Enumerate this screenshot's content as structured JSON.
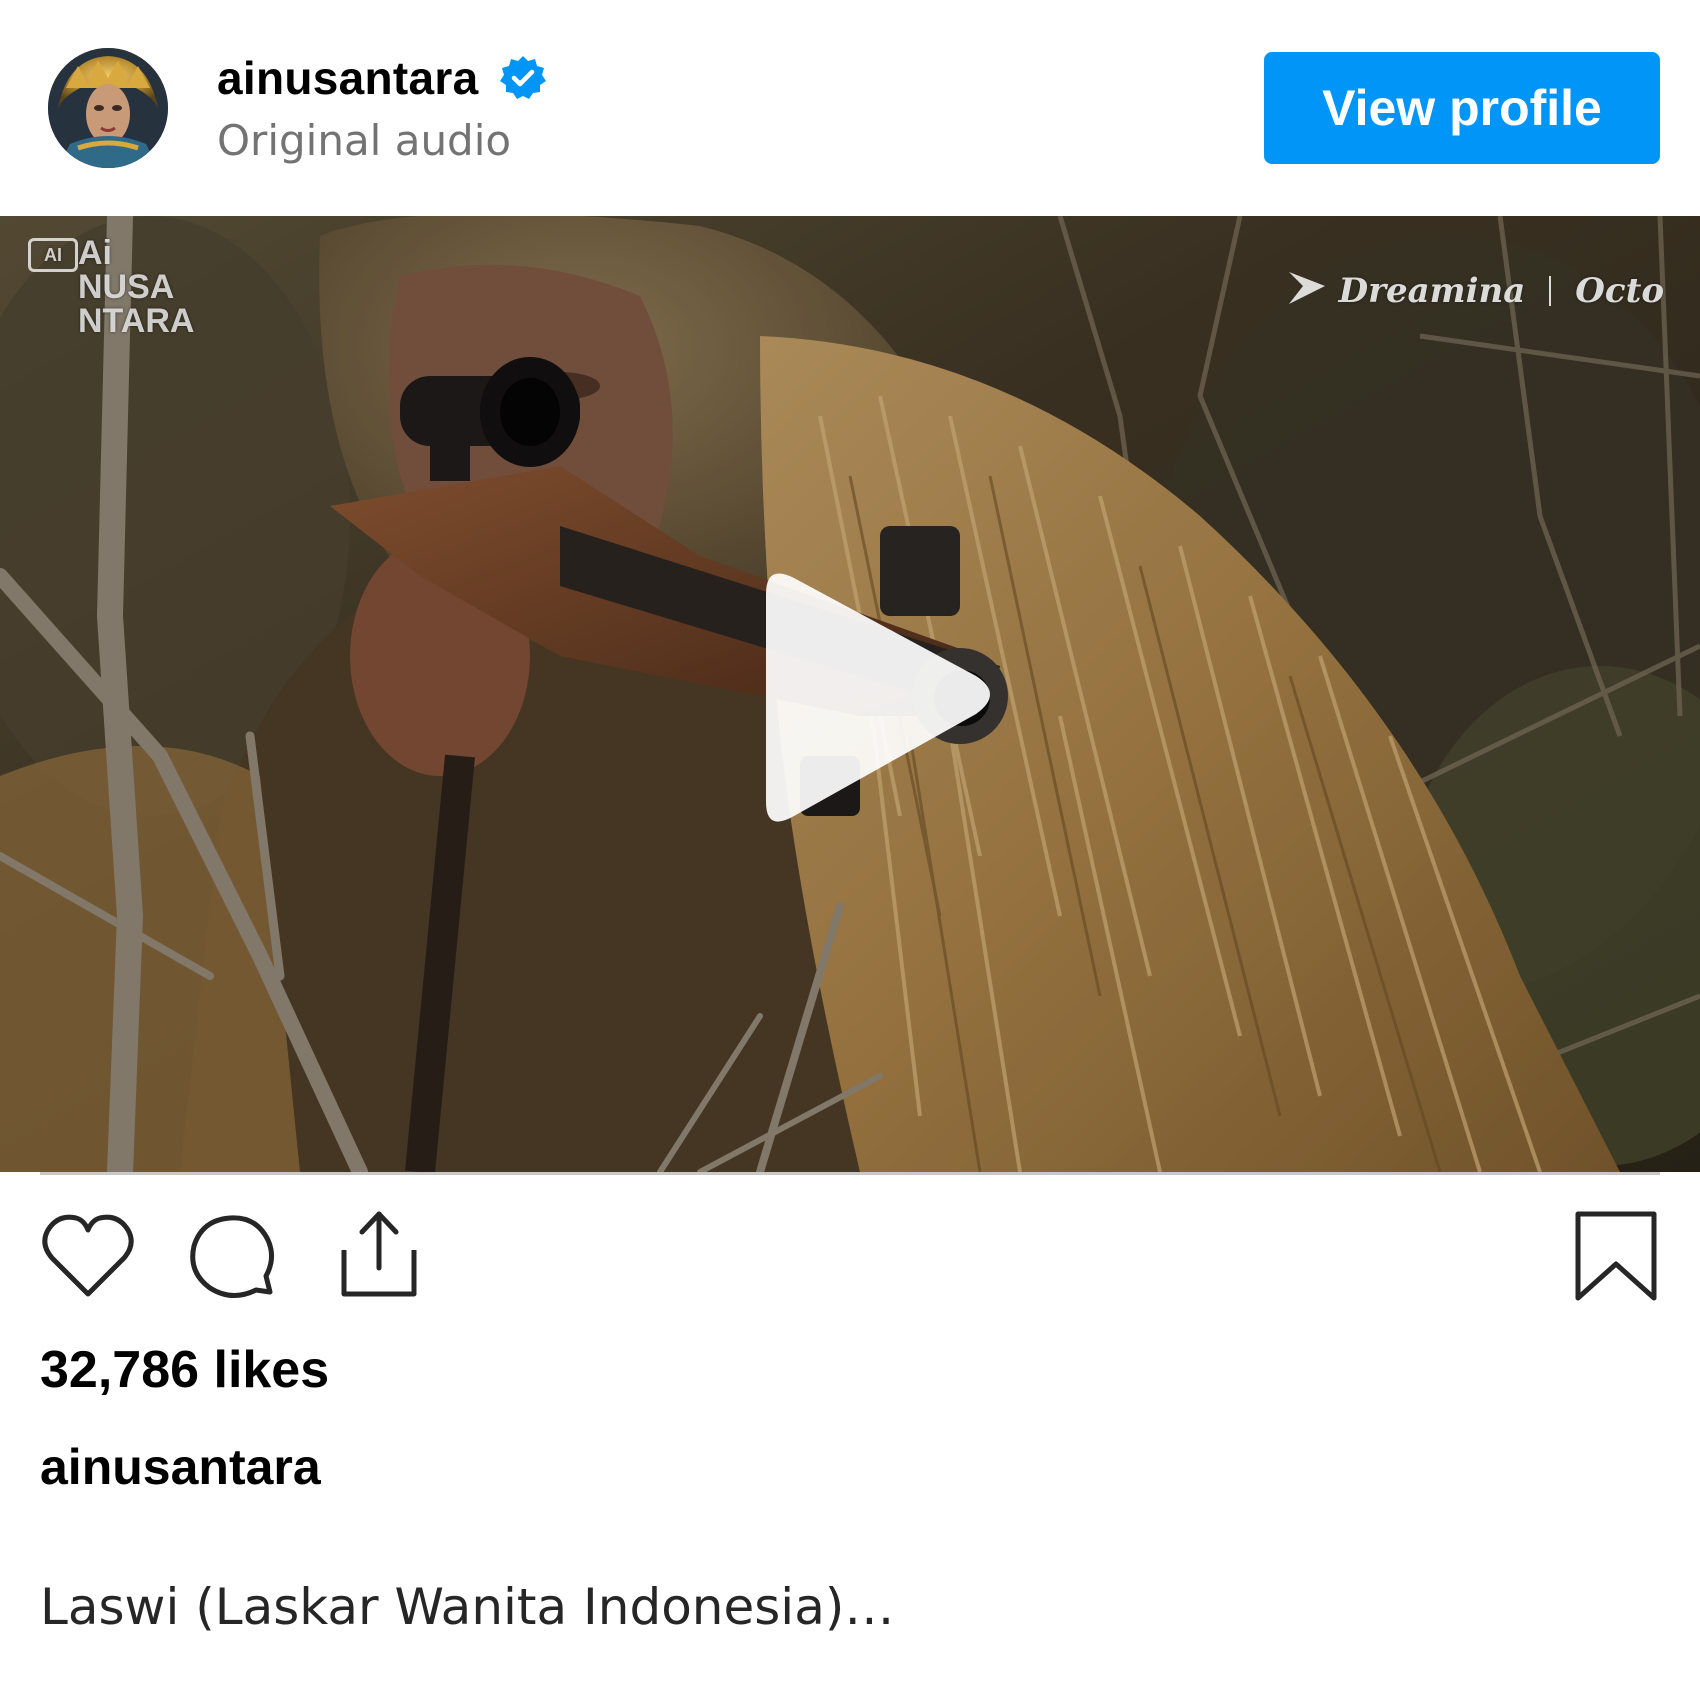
{
  "post": {
    "username": "ainusantara",
    "verified": true,
    "audio_label": "Original audio",
    "view_profile_label": "View profile",
    "likes_text": "32,786 likes",
    "caption_username": "ainusantara",
    "caption_text": "Laswi (Laskar Wanita Indonesia)…"
  },
  "media": {
    "type": "video",
    "watermark_left": {
      "badge": "AI",
      "line1": "Ai",
      "line2": "NUSA",
      "line3": "NTARA"
    },
    "watermark_right": {
      "brand1": "Dreamina",
      "brand2": "Octo"
    }
  },
  "icons": {
    "verified": "verified-badge-icon",
    "play": "play-icon",
    "like": "heart-icon",
    "comment": "comment-bubble-icon",
    "share": "share-icon",
    "save": "bookmark-icon"
  },
  "colors": {
    "button": "#0095f6",
    "verified": "#0095f6",
    "secondary_text": "#737373",
    "divider": "#c8c8c8"
  }
}
